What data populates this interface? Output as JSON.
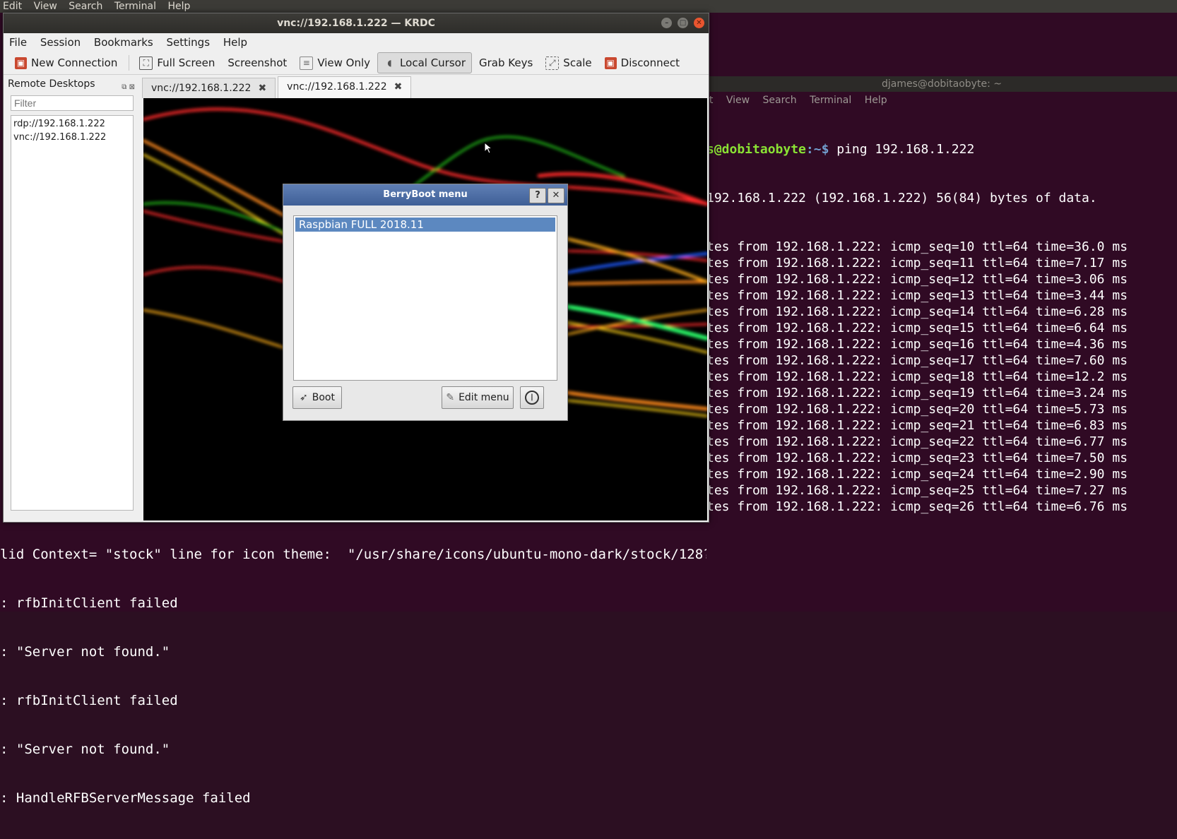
{
  "top_menu": [
    "Edit",
    "View",
    "Search",
    "Terminal",
    "Help"
  ],
  "background_terminal": {
    "lines": [
      "lid Context= \"stock\" line for icon theme:  \"/usr/share/icons/ubuntu-mono-dark/stock/128?\"",
      ": rfbInitClient failed",
      ": \"Server not found.\"",
      ": rfbInitClient failed",
      ": \"Server not found.\"",
      ": HandleRFBServerMessage failed"
    ]
  },
  "right_terminal": {
    "title": "djames@dobitaobyte: ~",
    "menu": [
      "it",
      "View",
      "Search",
      "Terminal",
      "Help"
    ],
    "prompt_user": "s@dobitaobyte",
    "prompt_dir": ":~$",
    "command": " ping 192.168.1.222",
    "header": "192.168.1.222 (192.168.1.222) 56(84) bytes of data.",
    "replies": [
      "tes from 192.168.1.222: icmp_seq=10 ttl=64 time=36.0 ms",
      "tes from 192.168.1.222: icmp_seq=11 ttl=64 time=7.17 ms",
      "tes from 192.168.1.222: icmp_seq=12 ttl=64 time=3.06 ms",
      "tes from 192.168.1.222: icmp_seq=13 ttl=64 time=3.44 ms",
      "tes from 192.168.1.222: icmp_seq=14 ttl=64 time=6.28 ms",
      "tes from 192.168.1.222: icmp_seq=15 ttl=64 time=6.64 ms",
      "tes from 192.168.1.222: icmp_seq=16 ttl=64 time=4.36 ms",
      "tes from 192.168.1.222: icmp_seq=17 ttl=64 time=7.60 ms",
      "tes from 192.168.1.222: icmp_seq=18 ttl=64 time=12.2 ms",
      "tes from 192.168.1.222: icmp_seq=19 ttl=64 time=3.24 ms",
      "tes from 192.168.1.222: icmp_seq=20 ttl=64 time=5.73 ms",
      "tes from 192.168.1.222: icmp_seq=21 ttl=64 time=6.83 ms",
      "tes from 192.168.1.222: icmp_seq=22 ttl=64 time=6.77 ms",
      "tes from 192.168.1.222: icmp_seq=23 ttl=64 time=7.50 ms",
      "tes from 192.168.1.222: icmp_seq=24 ttl=64 time=2.90 ms",
      "tes from 192.168.1.222: icmp_seq=25 ttl=64 time=7.27 ms",
      "tes from 192.168.1.222: icmp_seq=26 ttl=64 time=6.76 ms"
    ]
  },
  "krdc": {
    "title": "vnc://192.168.1.222 — KRDC",
    "menu": [
      "File",
      "Session",
      "Bookmarks",
      "Settings",
      "Help"
    ],
    "toolbar": {
      "new_connection": "New Connection",
      "full_screen": "Full Screen",
      "screenshot": "Screenshot",
      "view_only": "View Only",
      "local_cursor": "Local Cursor",
      "grab_keys": "Grab Keys",
      "scale": "Scale",
      "disconnect": "Disconnect"
    },
    "sidebar": {
      "title": "Remote Desktops",
      "filter_placeholder": "Filter",
      "items": [
        "rdp://192.168.1.222",
        "vnc://192.168.1.222"
      ]
    },
    "tabs": [
      {
        "label": "vnc://192.168.1.222",
        "active": false
      },
      {
        "label": "vnc://192.168.1.222",
        "active": true
      }
    ]
  },
  "berryboot": {
    "title": "BerryBoot menu",
    "help_label": "?",
    "close_label": "✕",
    "os_items": [
      "Raspbian FULL 2018.11"
    ],
    "boot_label": "Boot",
    "edit_menu_label": "Edit menu"
  },
  "colors": {
    "terminal_bg": "#300a24",
    "prompt_green": "#8ae234",
    "prompt_blue": "#729fcf",
    "selection_blue": "#5c88c0",
    "close_orange": "#e9552f"
  }
}
